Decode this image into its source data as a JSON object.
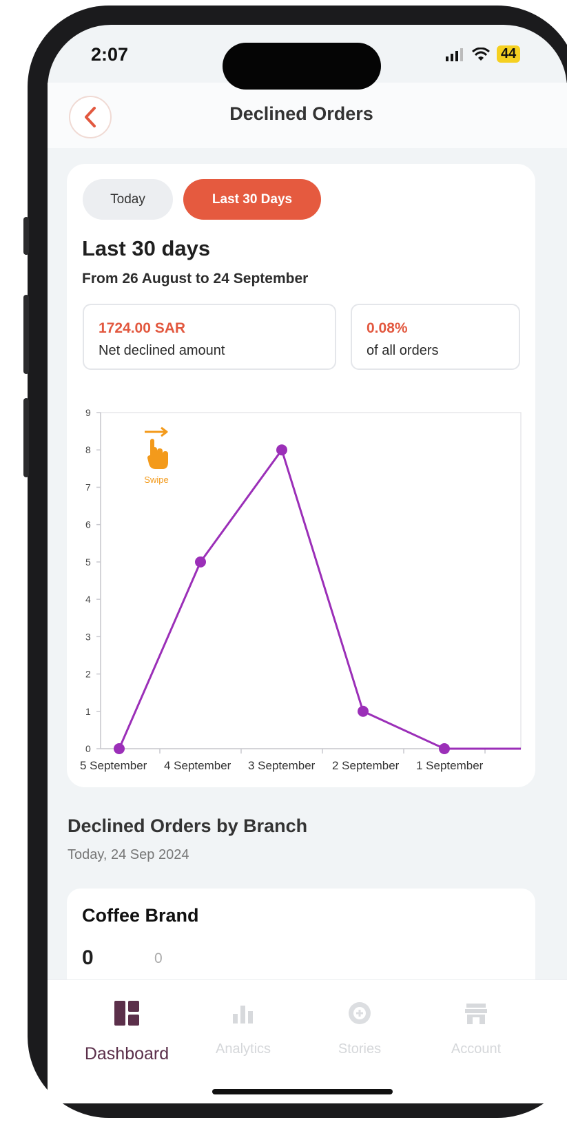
{
  "status_bar": {
    "time": "2:07",
    "battery": "44"
  },
  "header": {
    "title": "Declined Orders"
  },
  "period_tabs": {
    "today": "Today",
    "last_30": "Last 30 Days",
    "active": "Last 30 Days"
  },
  "summary": {
    "heading": "Last 30 days",
    "range": "From 26 August to 24 September",
    "net_amount_value": "1724.00 SAR",
    "net_amount_label": "Net declined amount",
    "share_value": "0.08%",
    "share_label": "of all orders"
  },
  "swipe_hint": {
    "label": "Swipe"
  },
  "chart_data": {
    "type": "line",
    "categories": [
      "5 September",
      "4 September",
      "3 September",
      "2 September",
      "1 September"
    ],
    "values": [
      0,
      5,
      8,
      1,
      0
    ],
    "ylim": [
      0,
      9
    ],
    "yticks": [
      0,
      1,
      2,
      3,
      4,
      5,
      6,
      7,
      8,
      9
    ],
    "color": "#9b2fb8",
    "grid": false
  },
  "branch_section": {
    "title": "Declined Orders by Branch",
    "date": "Today, 24 Sep 2024",
    "branch_name": "Coffee Brand",
    "count": "0",
    "secondary_count": "0"
  },
  "tab_bar": {
    "items": [
      {
        "label": "Dashboard",
        "icon": "dashboard-icon",
        "active": true
      },
      {
        "label": "Analytics",
        "icon": "bar-chart-icon",
        "active": false
      },
      {
        "label": "Stories",
        "icon": "stories-icon",
        "active": false
      },
      {
        "label": "Account",
        "icon": "store-icon",
        "active": false
      }
    ],
    "active_color": "#5b2f4a"
  },
  "colors": {
    "accent": "#e55a3f",
    "line": "#9b2fb8",
    "swipe": "#f39a1b"
  }
}
